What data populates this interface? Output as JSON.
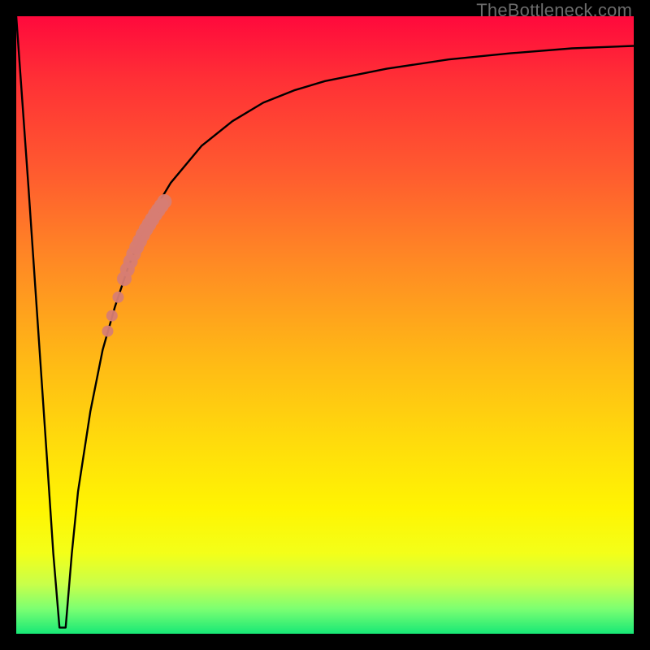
{
  "watermark": "TheBottleneck.com",
  "colors": {
    "curve": "#000000",
    "marker": "#d77d73",
    "background_top": "#ff093c",
    "background_bottom": "#17e876"
  },
  "chart_data": {
    "type": "line",
    "title": "",
    "xlabel": "",
    "ylabel": "",
    "xlim": [
      0,
      100
    ],
    "ylim": [
      0,
      100
    ],
    "grid": false,
    "legend": false,
    "note": "Bottleneck-style curve: value drops sharply from 100 to ~0 near x≈7 then climbs asymptotically toward ~95. No axis ticks or numeric labels are rendered in the image.",
    "series": [
      {
        "name": "bottleneck-curve",
        "x": [
          0,
          2,
          5,
          6,
          7,
          8,
          9,
          10,
          12,
          14,
          16,
          18,
          20,
          22,
          25,
          30,
          35,
          40,
          45,
          50,
          55,
          60,
          70,
          80,
          90,
          100
        ],
        "y": [
          100,
          72,
          28,
          13,
          1,
          1,
          13,
          23,
          36,
          46,
          53,
          59,
          64,
          68,
          73,
          79,
          83,
          86,
          88,
          89.5,
          90.5,
          91.5,
          93,
          94,
          94.8,
          95.2
        ]
      }
    ],
    "markers": {
      "name": "highlight-segment",
      "x": [
        17.5,
        18.0,
        18.5,
        19.0,
        19.5,
        20.0,
        20.5,
        21.0,
        21.5,
        22.0,
        22.5,
        23.0,
        23.5,
        24.0,
        16.5,
        15.5,
        14.8
      ],
      "y": [
        57.5,
        59.0,
        60.3,
        61.5,
        62.6,
        63.6,
        64.6,
        65.5,
        66.3,
        67.1,
        67.9,
        68.6,
        69.3,
        70.0,
        54.5,
        51.5,
        49.0
      ],
      "radius_main": 9,
      "radius_small": 7
    }
  }
}
